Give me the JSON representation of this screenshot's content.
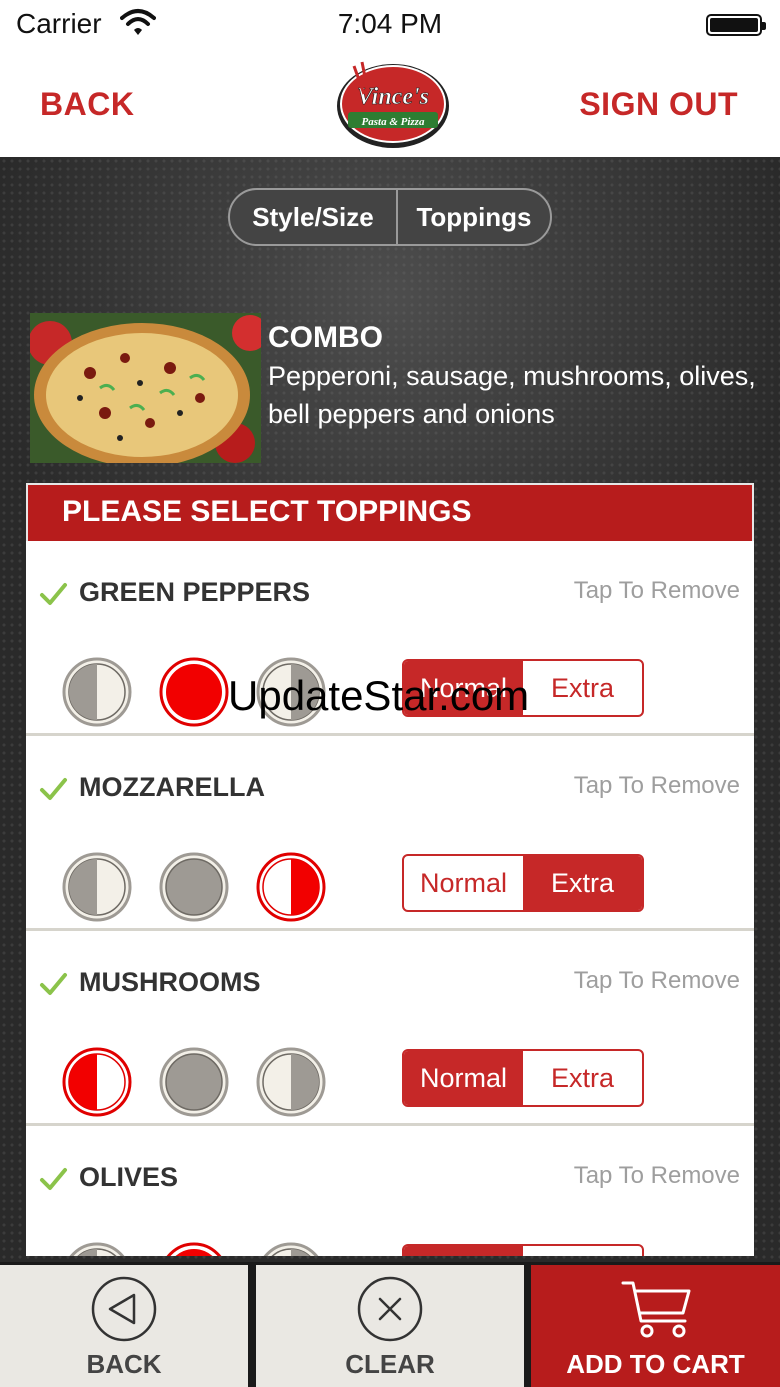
{
  "status_bar": {
    "carrier": "Carrier",
    "time": "7:04 PM"
  },
  "nav": {
    "back_label": "BACK",
    "sign_out_label": "SIGN OUT",
    "logo_text_main": "Vince's",
    "logo_text_sub": "Pasta & Pizza"
  },
  "tabs": {
    "style_size": "Style/Size",
    "toppings": "Toppings",
    "active": "Toppings"
  },
  "product": {
    "name": "COMBO",
    "description": "Pepperoni, sausage, mushrooms, olives, bell peppers and onions"
  },
  "toppings_panel": {
    "title": "PLEASE SELECT TOPPINGS",
    "tap_to_remove": "Tap To Remove",
    "normal_label": "Normal",
    "extra_label": "Extra",
    "items": [
      {
        "name": "GREEN PEPPERS",
        "portion_selected": "whole",
        "amount_selected": "Normal"
      },
      {
        "name": "MOZZARELLA",
        "portion_selected": "right-half",
        "amount_selected": "Extra"
      },
      {
        "name": "MUSHROOMS",
        "portion_selected": "left-half",
        "amount_selected": "Normal"
      },
      {
        "name": "OLIVES",
        "portion_selected": "whole",
        "amount_selected": "Normal"
      }
    ]
  },
  "watermark": "UpdateStar.com",
  "bottom_bar": {
    "back_label": "BACK",
    "clear_label": "CLEAR",
    "add_to_cart_label": "ADD TO CART"
  },
  "colors": {
    "brand_red": "#c62828",
    "panel_header_red": "#b71c1c",
    "portion_grey": "#9e9a94",
    "portion_cream": "#f3f0e8"
  },
  "icons": {
    "check": "check-icon",
    "back": "back-triangle-icon",
    "clear": "close-x-icon",
    "cart": "shopping-cart-icon"
  }
}
